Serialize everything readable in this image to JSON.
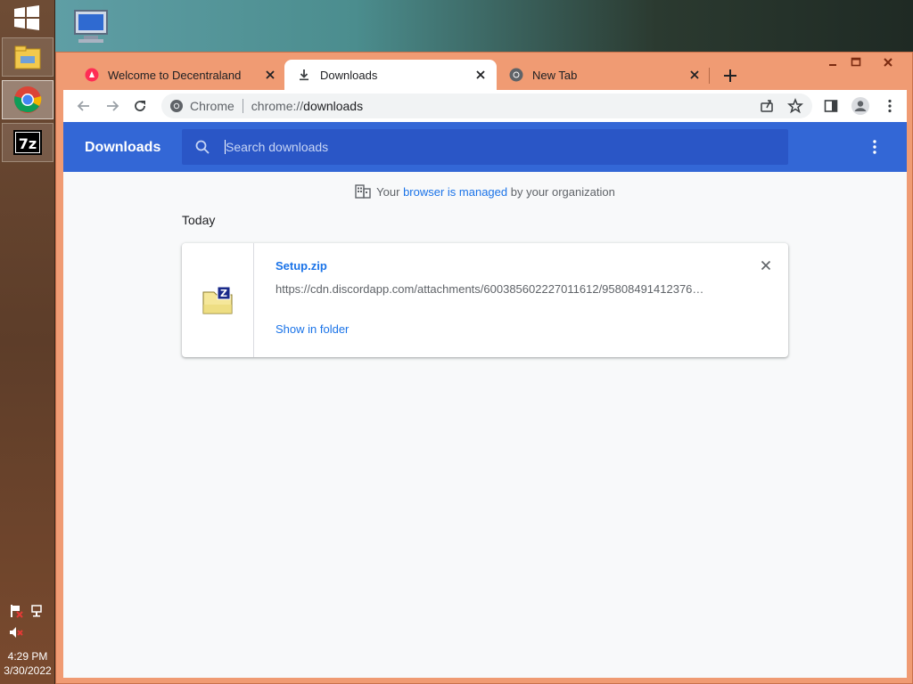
{
  "taskbar": {
    "clock_time": "4:29 PM",
    "clock_date": "3/30/2022",
    "pinned": [
      "file-explorer",
      "chrome",
      "7zip"
    ]
  },
  "tabs": [
    {
      "title": "Welcome to Decentraland",
      "icon": "decentraland-icon",
      "active": false
    },
    {
      "title": "Downloads",
      "icon": "download-icon",
      "active": true
    },
    {
      "title": "New Tab",
      "icon": "chrome-icon",
      "active": false
    }
  ],
  "omnibox": {
    "site_label": "Chrome",
    "url_scheme": "chrome://",
    "url_host": "downloads"
  },
  "downloads": {
    "title": "Downloads",
    "search_placeholder": "Search downloads",
    "managed_prefix": "Your",
    "managed_link": "browser is managed",
    "managed_suffix": "by your organization",
    "section_label": "Today",
    "items": [
      {
        "file_name": "Setup.zip",
        "url": "https://cdn.discordapp.com/attachments/600385602227011612/95808491412376…",
        "action_label": "Show in folder"
      }
    ]
  },
  "colors": {
    "window_frame": "#f09b73",
    "header_blue": "#3367d6",
    "search_blue": "#2a56c6",
    "link_blue": "#1a73e8"
  }
}
